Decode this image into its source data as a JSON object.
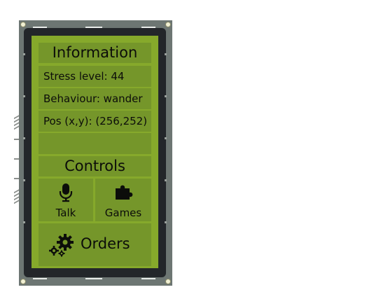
{
  "info": {
    "title": "Information",
    "stress": "Stress level: 44",
    "behaviour": "Behaviour: wander",
    "pos": "Pos (x,y): (256,252)",
    "empty": ""
  },
  "controls": {
    "title": "Controls",
    "talk": "Talk",
    "games": "Games",
    "orders": "Orders"
  },
  "colors": {
    "panel": "#86a92b",
    "cell": "#75962a",
    "frame": "#6d7673",
    "bezel": "#23262a"
  },
  "icons": {
    "talk": "microphone-icon",
    "games": "puzzle-piece-icon",
    "orders": "gears-icon"
  }
}
